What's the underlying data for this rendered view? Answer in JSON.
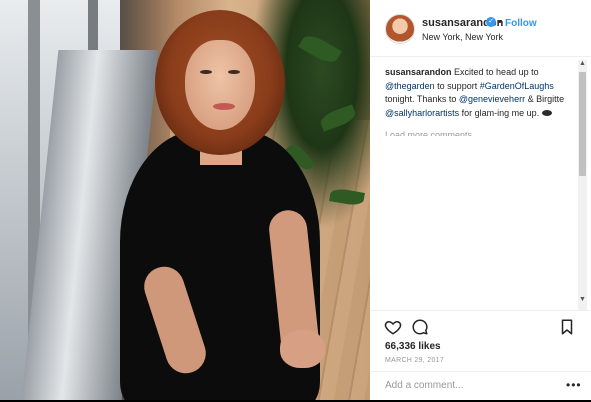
{
  "post": {
    "username": "susansarandon",
    "follow_label": "Follow",
    "location": "New York, New York",
    "caption": {
      "user": "susansarandon",
      "t1": " Excited to head up to ",
      "tag1": "@thegarden",
      "t2": " to support ",
      "tag2": "#GardenOfLaughs",
      "t3": " tonight. Thanks to ",
      "tag3": "@genevieveherr",
      "t4": " & Birgitte ",
      "tag4": "@sallyharlorartists",
      "t5": " for glam-ing me up. "
    },
    "load_more": "Load more comments",
    "likes": "66,336 likes",
    "date": "MARCH 29, 2017",
    "comment_placeholder": "Add a comment...",
    "more_label": "•••"
  },
  "icons": {
    "heart": "heart-icon",
    "comment": "comment-icon",
    "bookmark": "bookmark-icon",
    "verified": "verified-badge-icon"
  },
  "colors": {
    "accent": "#3897f0",
    "hashtag": "#003569",
    "text": "#262626",
    "muted": "#999999"
  }
}
